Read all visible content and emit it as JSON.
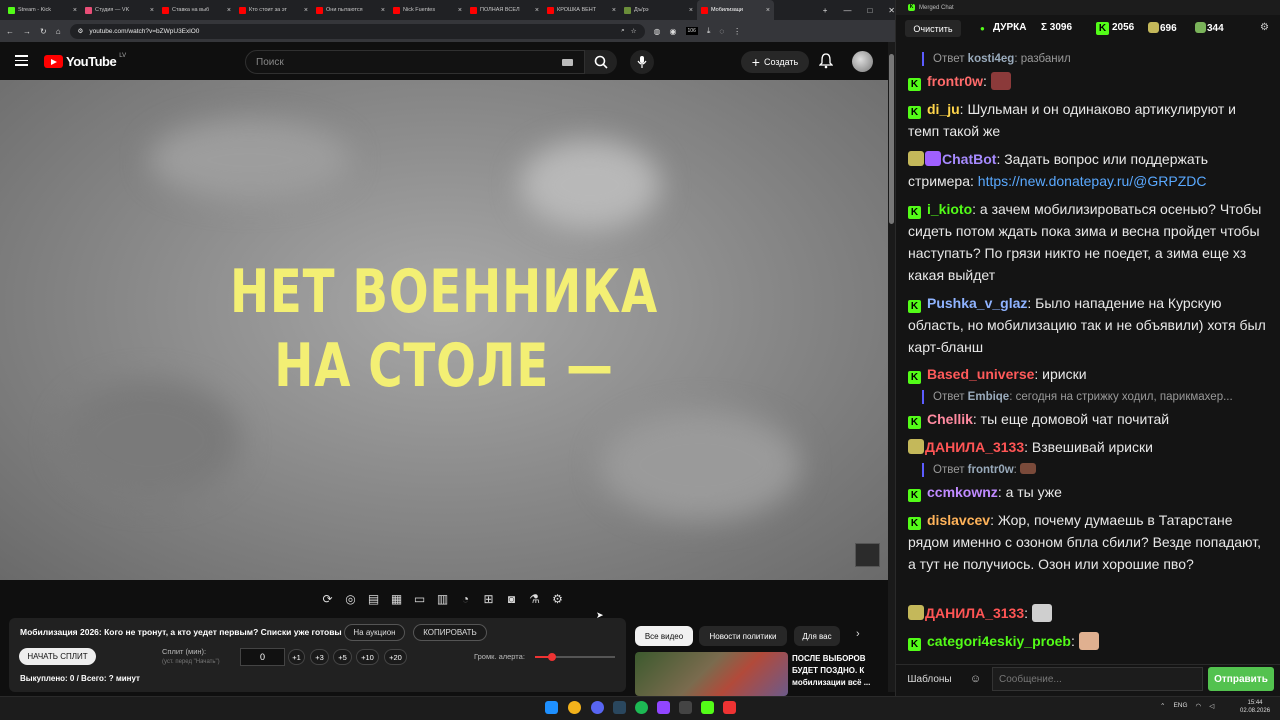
{
  "browser": {
    "tabs": [
      {
        "title": "Stream - Kick",
        "color": "#53fc18"
      },
      {
        "title": "Студия — VK",
        "color": "#e94e77"
      },
      {
        "title": "Ставка на выб",
        "color": "#ff0000"
      },
      {
        "title": "Кто стоит за эт",
        "color": "#ff0000"
      },
      {
        "title": "Они пытаются",
        "color": "#ff0000"
      },
      {
        "title": "Nick Fuentes",
        "color": "#ff0000"
      },
      {
        "title": "ПОЛНАЯ ВСЕЛ",
        "color": "#ff0000"
      },
      {
        "title": "КРОШКА ВЕНТ",
        "color": "#ff0000"
      },
      {
        "title": "Дъ/рэ",
        "color": "#6b8e3a"
      },
      {
        "title": "Мобилизаци",
        "color": "#ff0000",
        "active": true
      }
    ],
    "url": "youtube.com/watch?v=bZWpU3ExlO0",
    "ext_badge": "106"
  },
  "youtube": {
    "logo_text": "YouTube",
    "country": "LV",
    "search_placeholder": "Поиск",
    "create_label": "Создать",
    "video_caption_line1": "НЕТ ВОЕННИКА",
    "video_caption_line2": "НА СТОЛЕ —",
    "video_title": "Мобилизация 2026: Кого не тронут, а кто уедет первым? Списки уже готовы",
    "auction_btn": "На аукцион",
    "copy_btn": "КОПИРОВАТЬ",
    "start_split": "НАЧАТЬ СПЛИТ",
    "split_label": "Сплит (мин):",
    "split_hint": "(уст. перед \"Начать\")",
    "split_value": "0",
    "increments": [
      "+1",
      "+3",
      "+5",
      "+10",
      "+20"
    ],
    "alert_label": "Громк. алерта:",
    "alert_volume": 0.21,
    "bought_text": "Выкуплено: 0 / Всего: ? минут",
    "chips": [
      "Все видео",
      "Новости политики",
      "Для вас"
    ],
    "rec_title": "ПОСЛЕ ВЫБОРОВ БУДЕТ ПОЗДНО. К мобилизации всё ..."
  },
  "chat": {
    "window_title": "Merged Chat",
    "clear_btn": "Очистить",
    "channel": "ДУРКА",
    "sum": "Σ 3096",
    "kick_count": "2056",
    "count2": "696",
    "count3": "344",
    "messages": [
      {
        "type": "reply",
        "prefix": "Ответ ",
        "nick": "kosti4eg",
        "text": ": разбанил"
      },
      {
        "type": "msg",
        "nick": "frontr0w",
        "color": "#ff6b6b",
        "text": ": ",
        "emote": "#8b3a3a"
      },
      {
        "type": "msg",
        "nick": "di_ju",
        "color": "#ffd54a",
        "text": ": Шульман и он одинаково артикулируют и темп такой же"
      },
      {
        "type": "msg",
        "nick": "ChatBot",
        "color": "#a78bff",
        "text": ": Задать вопрос или поддержать стримера: ",
        "link": "https://new.donatepay.ru/@GRPZDC"
      },
      {
        "type": "msg",
        "nick": "i_kioto",
        "color": "#53fc18",
        "text": ": а зачем мобилизироваться осенью? Чтобы сидеть потом ждать пока зима и весна пройдет чтобы наступать? По грязи никто не поедет, а зима еще хз какая выйдет"
      },
      {
        "type": "msg",
        "nick": "Pushka_v_glaz",
        "color": "#8fb3ff",
        "text": ": Было нападение на Курскую область, но мобилизацию так и не объявили) хотя был карт-бланш"
      },
      {
        "type": "msg",
        "nick": "Based_universe",
        "color": "#ff5a5a",
        "text": ": ириски"
      },
      {
        "type": "reply",
        "prefix": "Ответ ",
        "nick": "Embiqe",
        "text": ": сегодня на стрижку ходил, парикмахер..."
      },
      {
        "type": "msg",
        "nick": "Chellik",
        "color": "#ff8aa0",
        "text": ": ты еще домовой чат почитай"
      },
      {
        "type": "msg",
        "nick": "ДАНИЛА_3133",
        "color": "#ff5555",
        "text": ": Взвешивай ириски"
      },
      {
        "type": "reply",
        "prefix": "Ответ ",
        "nick": "frontr0w",
        "text": ": "
      },
      {
        "type": "msg",
        "nick": "ccmkownz",
        "color": "#c08bff",
        "text": ": а ты уже"
      },
      {
        "type": "msg",
        "nick": "dislavcev",
        "color": "#ffb35a",
        "text": ": Жор, почему думаешь в Татарстане рядом именно с озоном бпла сбили? Везде попадают, а тут не получиось. Озон или хорошие пво?"
      },
      {
        "type": "msg",
        "nick": "ДАНИЛА_3133",
        "color": "#ff5555",
        "text": ": ",
        "emote": "#cfcfcf"
      },
      {
        "type": "msg",
        "nick": "categori4eskiy_proeb",
        "color": "#53fc18",
        "text": ": ",
        "emote": "#e0b090"
      }
    ],
    "templates_btn": "Шаблоны",
    "input_placeholder": "Сообщение...",
    "send_btn": "Отправить"
  },
  "taskbar": {
    "lang": "ENG",
    "time": "15:44",
    "date": "02.08.2026"
  },
  "colors": {
    "kick": "#53fc18",
    "yt_red": "#ff0000",
    "caption": "#f3ef74"
  }
}
